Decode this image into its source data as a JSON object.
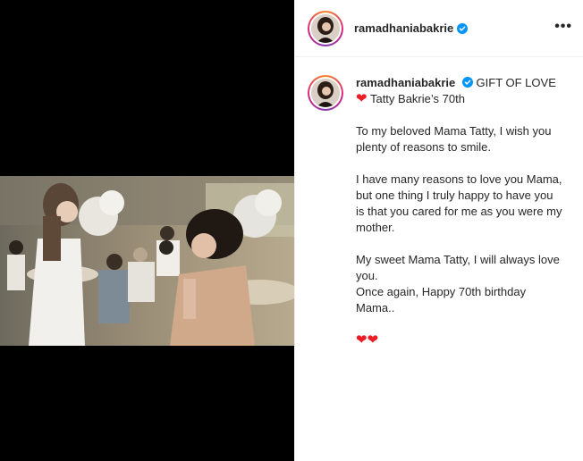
{
  "post": {
    "username": "ramadhaniabakrie",
    "verified": true,
    "more_label": "•••"
  },
  "caption": {
    "title": "GIFT OF LOVE",
    "subtitle": "Tatty Bakrie’s 70th",
    "para1": "To my beloved Mama Tatty, I wish you plenty of reasons to smile.",
    "para2": "I have many reasons to love you Mama, but one thing I truly happy to have you is that you cared for me as you were my mother.",
    "para3_line1": "My sweet Mama Tatty, I will always love you.",
    "para3_line2": "Once again, Happy 70th birthday Mama..",
    "heart": "❤",
    "hearts_end": "❤❤"
  },
  "colors": {
    "verified_blue": "#0095f6",
    "heart_red": "#ed1c24"
  },
  "icons": [
    "verified-badge-icon",
    "more-options-icon",
    "heart-icon"
  ]
}
